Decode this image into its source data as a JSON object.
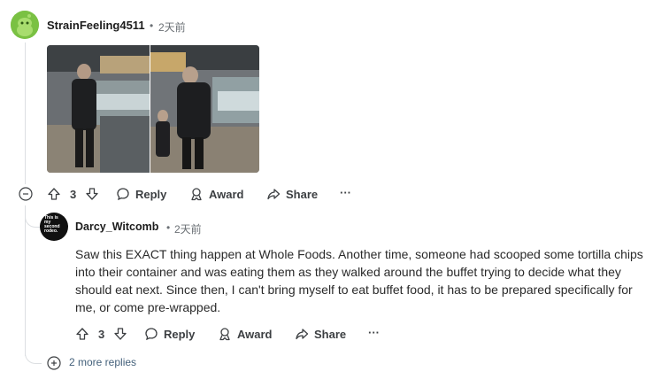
{
  "comment1": {
    "username": "StrainFeeling4511",
    "time": "2天前",
    "upvotes": "3",
    "reply_label": "Reply",
    "award_label": "Award",
    "share_label": "Share",
    "more_label": "···"
  },
  "comment2": {
    "username": "Darcy_Witcomb",
    "time": "2天前",
    "avatar_text": "This is my second rodeo.",
    "body": "Saw this EXACT thing happen at Whole Foods. Another time, someone had scooped some tortilla chips into their container and was eating them as they walked around the buffet trying to decide what they should eat next. Since then, I can't bring myself to eat buffet food, it has to be prepared specifically for me, or come pre-wrapped.",
    "upvotes": "3",
    "reply_label": "Reply",
    "award_label": "Award",
    "share_label": "Share",
    "more_label": "···"
  },
  "thread": {
    "more_replies": "2 more replies"
  },
  "colors": {
    "accent_avatar1": "#7ac143",
    "thread_line": "#dcdfe2",
    "action_text": "#3c3f42"
  }
}
